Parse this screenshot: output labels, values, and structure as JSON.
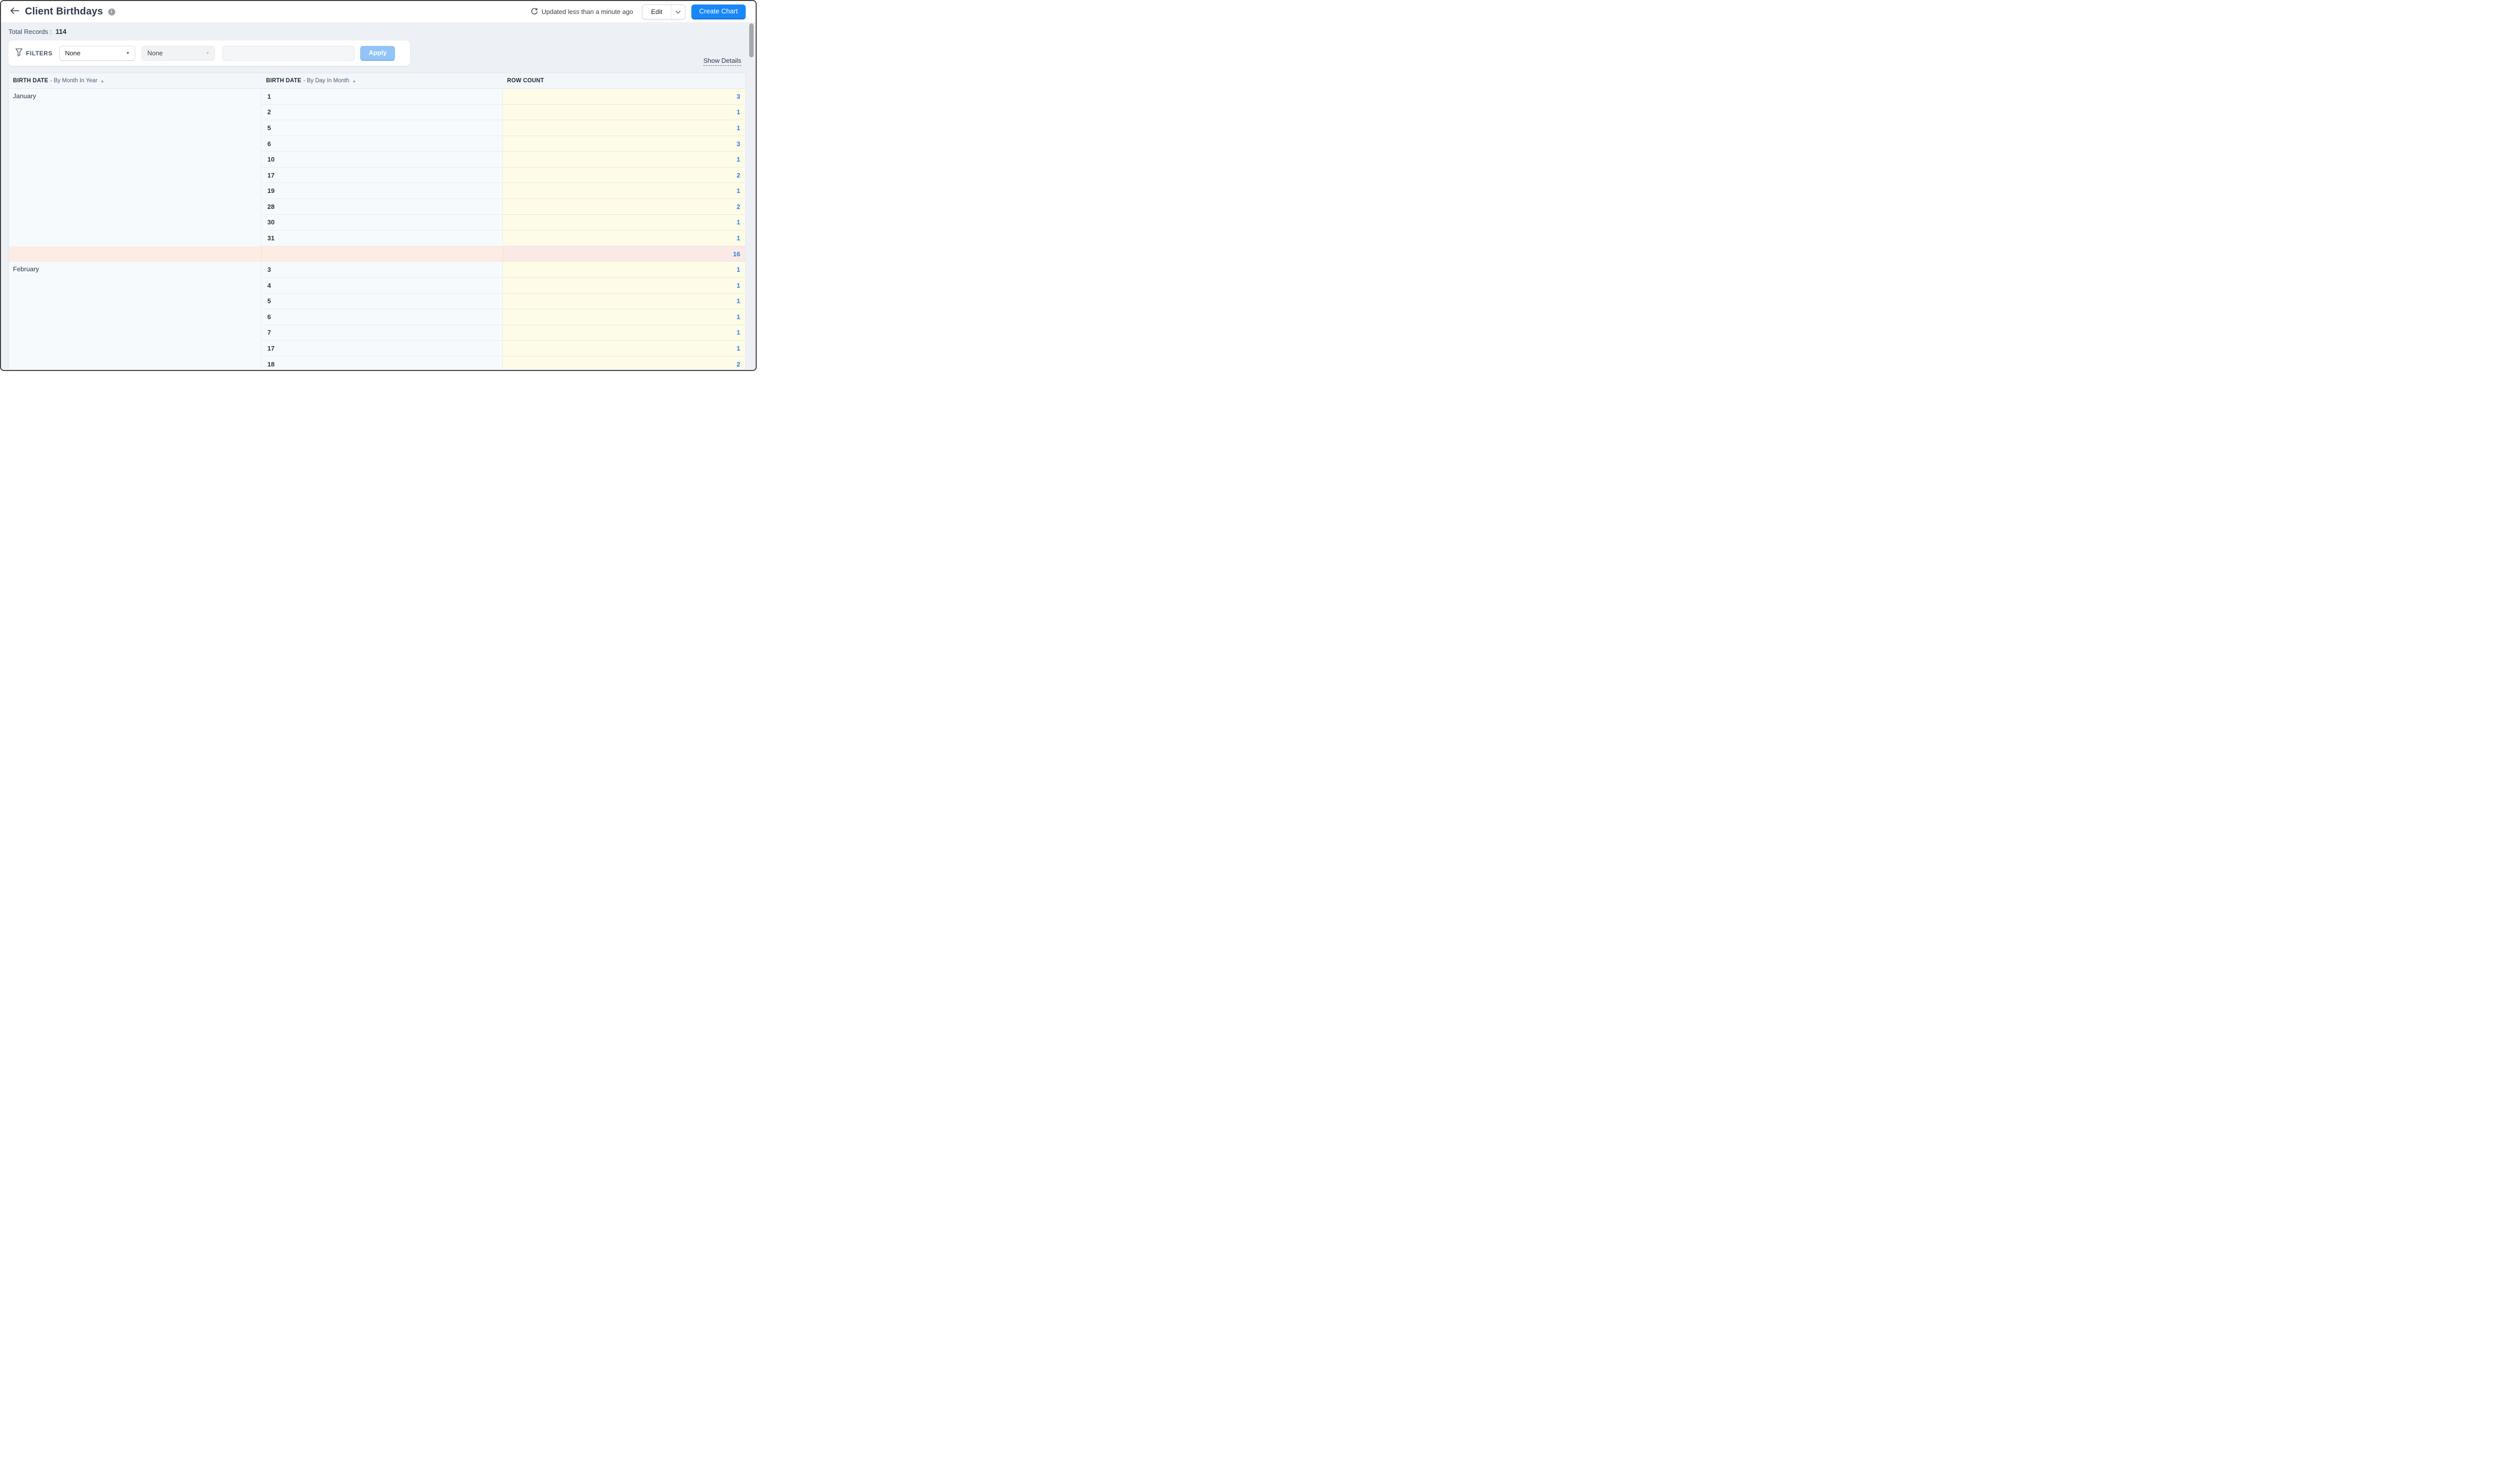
{
  "header": {
    "title": "Client Birthdays",
    "updated_text": "Updated less than a minute ago",
    "edit_label": "Edit",
    "create_chart_label": "Create Chart"
  },
  "total": {
    "label": "Total Records :",
    "value": "114"
  },
  "filters": {
    "label": "FILTERS",
    "field_value": "None",
    "operator_value": "None",
    "input_value": "",
    "apply_label": "Apply"
  },
  "show_details": "Show Details",
  "icons": {
    "back": "arrow-left",
    "info": "info-circle",
    "refresh": "refresh-circular-arrow",
    "filter": "funnel",
    "dropdown_caret": "▼",
    "sort_ascending": "▲",
    "edit_caret": "chevron-down"
  },
  "table": {
    "columns": [
      {
        "field": "BIRTH DATE",
        "modifier": "By Month In Year",
        "sorted": "asc"
      },
      {
        "field": "BIRTH DATE",
        "modifier": "By Day In Month",
        "sorted": "asc"
      },
      {
        "field": "ROW COUNT",
        "modifier": "",
        "sorted": ""
      }
    ],
    "groups": [
      {
        "month": "January",
        "rows": [
          {
            "day": "1",
            "count": "3"
          },
          {
            "day": "2",
            "count": "1"
          },
          {
            "day": "5",
            "count": "1"
          },
          {
            "day": "6",
            "count": "3"
          },
          {
            "day": "10",
            "count": "1"
          },
          {
            "day": "17",
            "count": "2"
          },
          {
            "day": "19",
            "count": "1"
          },
          {
            "day": "28",
            "count": "2"
          },
          {
            "day": "30",
            "count": "1"
          },
          {
            "day": "31",
            "count": "1"
          }
        ],
        "subtotal": "16"
      },
      {
        "month": "February",
        "rows": [
          {
            "day": "3",
            "count": "1"
          },
          {
            "day": "4",
            "count": "1"
          },
          {
            "day": "5",
            "count": "1"
          },
          {
            "day": "6",
            "count": "1"
          },
          {
            "day": "7",
            "count": "1"
          },
          {
            "day": "17",
            "count": "1"
          },
          {
            "day": "18",
            "count": "2"
          }
        ],
        "subtotal": null
      }
    ]
  },
  "colors": {
    "accent_blue": "#1a87f8",
    "apply_disabled_blue": "#92c4f9",
    "count_link_blue": "#2d7ee9",
    "count_column_bg": "#fefce6",
    "subtotal_row_bg": "#fcece4",
    "page_bg": "#edf0f5",
    "row_bg": "#f7fafd",
    "title_text": "#2e3a4f"
  }
}
